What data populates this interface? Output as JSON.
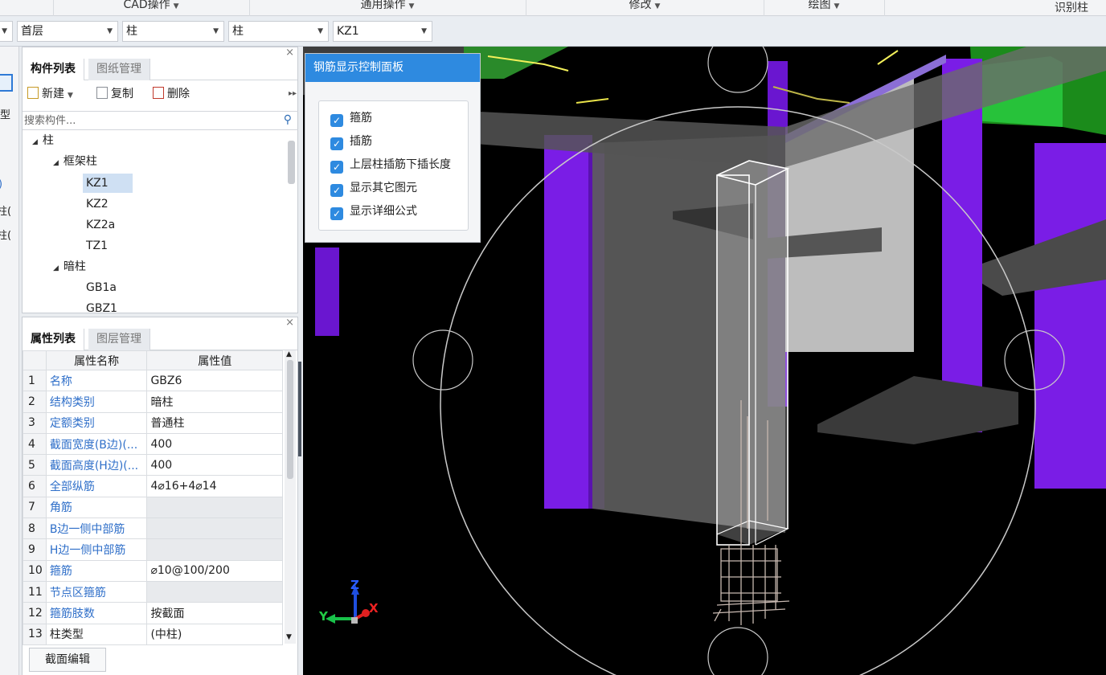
{
  "menu": {
    "items": [
      {
        "label": "CAD操作"
      },
      {
        "label": "通用操作"
      },
      {
        "label": "修改"
      },
      {
        "label": "绘图"
      }
    ],
    "right_label": "识别柱"
  },
  "selectors": {
    "floor": "首层",
    "category": "柱",
    "subtype": "柱",
    "component": "KZ1"
  },
  "left_stub": {
    "labels": [
      "型",
      ")",
      "柱(",
      "柱("
    ]
  },
  "component_panel": {
    "tabs": [
      "构件列表",
      "图纸管理"
    ],
    "toolbar": {
      "new_label": "新建",
      "copy_label": "复制",
      "delete_label": "删除"
    },
    "search_placeholder": "搜索构件...",
    "tree": {
      "root": "柱",
      "groups": [
        {
          "label": "框架柱",
          "items": [
            "KZ1",
            "KZ2",
            "KZ2a",
            "TZ1"
          ]
        },
        {
          "label": "暗柱",
          "items": [
            "GB1a",
            "GBZ1"
          ]
        }
      ],
      "selected": "KZ1"
    }
  },
  "property_panel": {
    "tabs": [
      "属性列表",
      "图层管理"
    ],
    "headers": {
      "name": "属性名称",
      "value": "属性值"
    },
    "rows": [
      {
        "num": "1",
        "name": "名称",
        "value": "GBZ6"
      },
      {
        "num": "2",
        "name": "结构类别",
        "value": "暗柱"
      },
      {
        "num": "3",
        "name": "定额类别",
        "value": "普通柱"
      },
      {
        "num": "4",
        "name": "截面宽度(B边)(...",
        "value": "400"
      },
      {
        "num": "5",
        "name": "截面高度(H边)(...",
        "value": "400"
      },
      {
        "num": "6",
        "name": "全部纵筋",
        "value": "4⌀16+4⌀14"
      },
      {
        "num": "7",
        "name": "角筋",
        "value": ""
      },
      {
        "num": "8",
        "name": "B边一侧中部筋",
        "value": ""
      },
      {
        "num": "9",
        "name": "H边一侧中部筋",
        "value": ""
      },
      {
        "num": "10",
        "name": "箍筋",
        "value": "⌀10@100/200"
      },
      {
        "num": "11",
        "name": "节点区箍筋",
        "value": ""
      },
      {
        "num": "12",
        "name": "箍筋肢数",
        "value": "按截面"
      },
      {
        "num": "13",
        "name": "柱类型",
        "value": "(中柱)"
      }
    ],
    "section_edit_label": "截面编辑"
  },
  "rebar_panel": {
    "title": "钢筋显示控制面板",
    "options": [
      {
        "label": "箍筋",
        "checked": true
      },
      {
        "label": "插筋",
        "checked": true
      },
      {
        "label": "上层柱插筋下插长度",
        "checked": true
      },
      {
        "label": "显示其它图元",
        "checked": true
      },
      {
        "label": "显示详细公式",
        "checked": true
      }
    ]
  },
  "axes": {
    "x": "X",
    "y": "Y",
    "z": "Z"
  },
  "colors": {
    "accent": "#2e8ae0",
    "purple": "#7a1de6",
    "green": "#27c23a",
    "link": "#2f6fc9"
  }
}
